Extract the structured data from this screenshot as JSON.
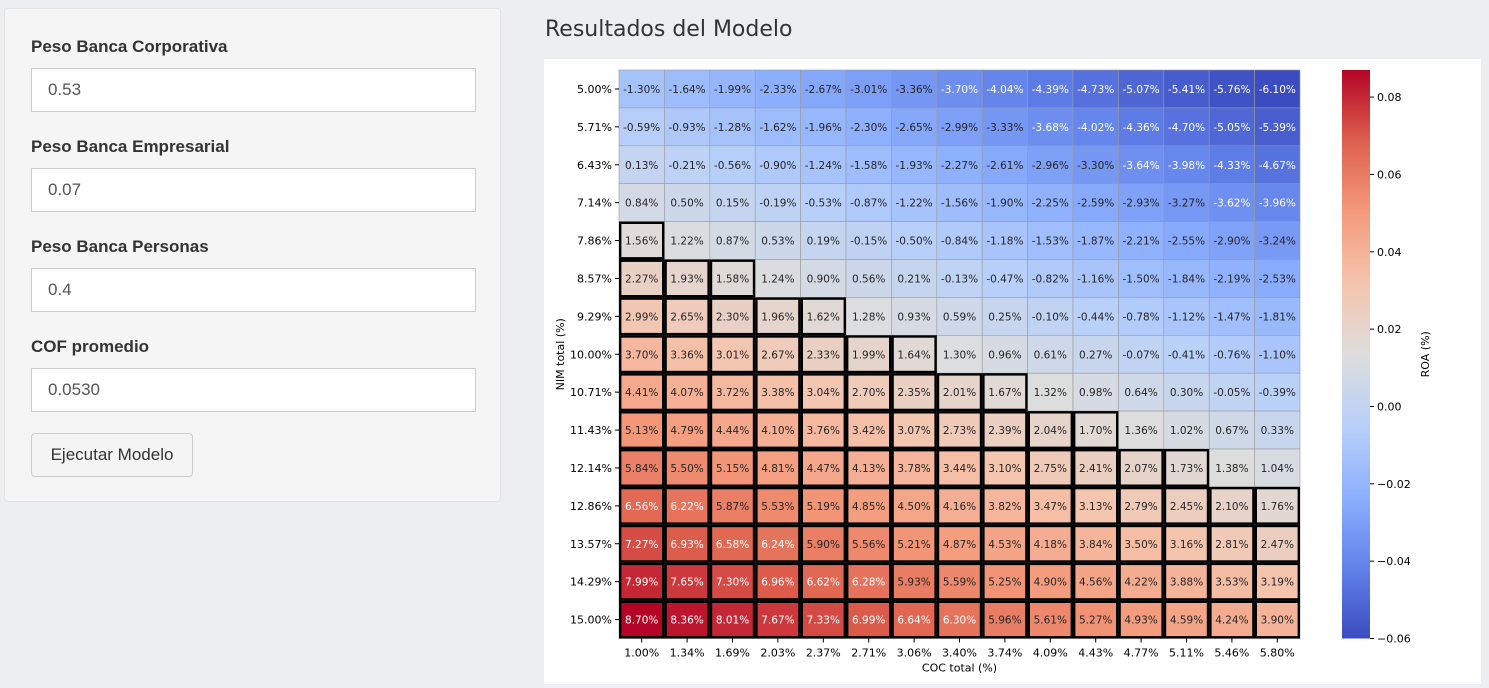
{
  "sidebar": {
    "fields": [
      {
        "label": "Peso Banca Corporativa",
        "value": "0.53"
      },
      {
        "label": "Peso Banca Empresarial",
        "value": "0.07"
      },
      {
        "label": "Peso Banca Personas",
        "value": "0.4"
      },
      {
        "label": "COF promedio",
        "value": "0.0530"
      }
    ],
    "run_button": "Ejecutar Modelo"
  },
  "main": {
    "title": "Resultados del Modelo"
  },
  "chart_data": {
    "type": "heatmap",
    "title": "",
    "xlabel": "COC total (%)",
    "ylabel": "NIM total (%)",
    "colorbar_label": "ROA (%)",
    "colormap": "coolwarm",
    "colorbar_range": [
      -0.06,
      0.087
    ],
    "colorbar_ticks": [
      "0.08",
      "0.06",
      "0.04",
      "0.02",
      "0.00",
      "−0.02",
      "−0.04",
      "−0.06"
    ],
    "colorbar_tick_values": [
      0.08,
      0.06,
      0.04,
      0.02,
      0.0,
      -0.02,
      -0.04,
      -0.06
    ],
    "x_tick_labels": [
      "1.00%",
      "1.34%",
      "1.69%",
      "2.03%",
      "2.37%",
      "2.71%",
      "3.06%",
      "3.40%",
      "3.74%",
      "4.09%",
      "4.43%",
      "4.77%",
      "5.11%",
      "5.46%",
      "5.80%"
    ],
    "y_tick_labels": [
      "5.00%",
      "5.71%",
      "6.43%",
      "7.14%",
      "7.86%",
      "8.57%",
      "9.29%",
      "10.00%",
      "10.71%",
      "11.43%",
      "12.14%",
      "12.86%",
      "13.57%",
      "14.29%",
      "15.00%"
    ],
    "values": [
      [
        -1.3,
        -1.64,
        -1.99,
        -2.33,
        -2.67,
        -3.01,
        -3.36,
        -3.7,
        -4.04,
        -4.39,
        -4.73,
        -5.07,
        -5.41,
        -5.76,
        -6.1
      ],
      [
        -0.59,
        -0.93,
        -1.28,
        -1.62,
        -1.96,
        -2.3,
        -2.65,
        -2.99,
        -3.33,
        -3.68,
        -4.02,
        -4.36,
        -4.7,
        -5.05,
        -5.39
      ],
      [
        0.13,
        -0.21,
        -0.56,
        -0.9,
        -1.24,
        -1.58,
        -1.93,
        -2.27,
        -2.61,
        -2.96,
        -3.3,
        -3.64,
        -3.98,
        -4.33,
        -4.67
      ],
      [
        0.84,
        0.5,
        0.15,
        -0.19,
        -0.53,
        -0.87,
        -1.22,
        -1.56,
        -1.9,
        -2.25,
        -2.59,
        -2.93,
        -3.27,
        -3.62,
        -3.96
      ],
      [
        1.56,
        1.22,
        0.87,
        0.53,
        0.19,
        -0.15,
        -0.5,
        -0.84,
        -1.18,
        -1.53,
        -1.87,
        -2.21,
        -2.55,
        -2.9,
        -3.24
      ],
      [
        2.27,
        1.93,
        1.58,
        1.24,
        0.9,
        0.56,
        0.21,
        -0.13,
        -0.47,
        -0.82,
        -1.16,
        -1.5,
        -1.84,
        -2.19,
        -2.53
      ],
      [
        2.99,
        2.65,
        2.3,
        1.96,
        1.62,
        1.28,
        0.93,
        0.59,
        0.25,
        -0.1,
        -0.44,
        -0.78,
        -1.12,
        -1.47,
        -1.81
      ],
      [
        3.7,
        3.36,
        3.01,
        2.67,
        2.33,
        1.99,
        1.64,
        1.3,
        0.96,
        0.61,
        0.27,
        -0.07,
        -0.41,
        -0.76,
        -1.1
      ],
      [
        4.41,
        4.07,
        3.72,
        3.38,
        3.04,
        2.7,
        2.35,
        2.01,
        1.67,
        1.32,
        0.98,
        0.64,
        0.3,
        -0.05,
        -0.39
      ],
      [
        5.13,
        4.79,
        4.44,
        4.1,
        3.76,
        3.42,
        3.07,
        2.73,
        2.39,
        2.04,
        1.7,
        1.36,
        1.02,
        0.67,
        0.33
      ],
      [
        5.84,
        5.5,
        5.15,
        4.81,
        4.47,
        4.13,
        3.78,
        3.44,
        3.1,
        2.75,
        2.41,
        2.07,
        1.73,
        1.38,
        1.04
      ],
      [
        6.56,
        6.22,
        5.87,
        5.53,
        5.19,
        4.85,
        4.5,
        4.16,
        3.82,
        3.47,
        3.13,
        2.79,
        2.45,
        2.1,
        1.76
      ],
      [
        7.27,
        6.93,
        6.58,
        6.24,
        5.9,
        5.56,
        5.21,
        4.87,
        4.53,
        4.18,
        3.84,
        3.5,
        3.16,
        2.81,
        2.47
      ],
      [
        7.99,
        7.65,
        7.3,
        6.96,
        6.62,
        6.28,
        5.93,
        5.59,
        5.25,
        4.9,
        4.56,
        4.22,
        3.88,
        3.53,
        3.19
      ],
      [
        8.7,
        8.36,
        8.01,
        7.67,
        7.33,
        6.99,
        6.64,
        6.3,
        5.96,
        5.61,
        5.27,
        4.93,
        4.59,
        4.24,
        3.9
      ]
    ],
    "highlight_threshold": 1.5,
    "value_format": "{v}%"
  }
}
